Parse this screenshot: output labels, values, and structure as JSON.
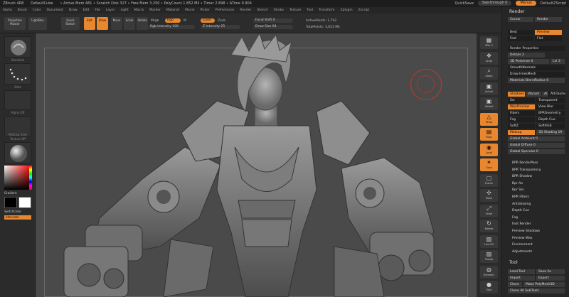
{
  "titlebar": {
    "app": "ZBrush 4R8",
    "document": "DefaultCube",
    "stats": "• Active Mem 481 • Scratch Disk 327 • Free Mem 3.250 • PolyCount 1.852 Mil • Timer 2.898 • ATime 9.904",
    "quicksave": "QuickSave",
    "see_through": "See-through 0",
    "menus": "Menus",
    "script": "DefaultZScript"
  },
  "menubar": [
    "Alpha",
    "Brush",
    "Color",
    "Document",
    "Draw",
    "Edit",
    "File",
    "Layer",
    "Light",
    "Macro",
    "Marker",
    "Material",
    "Movie",
    "Picker",
    "Preferences",
    "Render",
    "Stencil",
    "Stroke",
    "Texture",
    "Tool",
    "Transform",
    "Zplugin",
    "Zscript"
  ],
  "toolbar": {
    "projection_master": "Projection Master",
    "lightbox": "LightBox",
    "quick_sketch": "Quick Sketch",
    "edit": "Edit",
    "draw": "Draw",
    "move": "Move",
    "scale": "Scale",
    "rotate": "Rotate",
    "mrgb": "Mrgb",
    "rgb": "Rgb",
    "m": "M",
    "rgb_intensity": "Rgb Intensity",
    "zadd": "Zadd",
    "zsub": "Zsub",
    "z_intensity": "Z Intensity 25",
    "focal_shift": "Focal Shift 0",
    "draw_size": "Draw Size 64",
    "active_points": "ActivePoints: 1,792",
    "total_points": "TotalPoints: 3,653 Mil"
  },
  "leftshelf": {
    "labels": [
      "Standard",
      "Dots",
      "Alpha Off",
      "Texture Off",
      "MatCap Gray"
    ],
    "gradient": "Gradient",
    "switch_color": "SwitchColor",
    "alternate": "Alternate"
  },
  "rightshelf": [
    {
      "label": "SPix 3",
      "glyph": "▦",
      "orange": false
    },
    {
      "label": "Scroll",
      "glyph": "✥",
      "orange": false
    },
    {
      "label": "Zoom",
      "glyph": "⌕",
      "orange": false
    },
    {
      "label": "Actual",
      "glyph": "▣",
      "orange": false
    },
    {
      "label": "AAHalf",
      "glyph": "▣",
      "orange": false
    },
    {
      "label": "Persp",
      "glyph": "△",
      "orange": true
    },
    {
      "label": "Floor",
      "glyph": "▤",
      "orange": true
    },
    {
      "label": "Local",
      "glyph": "◉",
      "orange": true
    },
    {
      "label": "Gxyz",
      "glyph": "✶",
      "orange": true
    },
    {
      "label": "Frame",
      "glyph": "▢",
      "orange": false
    },
    {
      "label": "Move",
      "glyph": "✣",
      "orange": false
    },
    {
      "label": "Scale",
      "glyph": "⤢",
      "orange": false
    },
    {
      "label": "Rotate",
      "glyph": "↻",
      "orange": false
    },
    {
      "label": "Line Fill",
      "glyph": "▧",
      "orange": false
    },
    {
      "label": "Transp",
      "glyph": "▨",
      "orange": false
    },
    {
      "label": "Dynamic",
      "glyph": "◍",
      "orange": false
    },
    {
      "label": "Solo",
      "glyph": "●",
      "orange": false
    }
  ],
  "render_tray": {
    "title": "Render",
    "cursor": "Cursor",
    "render": "Render",
    "best": "Best",
    "preview": "Preview",
    "fast": "Fast",
    "flat": "Flat",
    "render_properties": "Render Properties",
    "details": "Details 2",
    "3d_posterize": "3D Posterize 0",
    "lvl": "Lvl 3",
    "smooth_normals": "SmoothNormals",
    "draw_hires": "Draw HiresMesh",
    "materials_blend": "Materials BlendRadius 0",
    "shadows": "Shadows",
    "vibrant": "Vibrant",
    "ao": "AO",
    "attributes": "Attributes",
    "ssr": "Ssr",
    "transparent": "Transparent",
    "wax_preview": "WaxPreview",
    "view_blur": "View Blur",
    "fibers": "Fibers",
    "bpr_geometry": "BPRGeometry",
    "fog": "Fog",
    "depth_cue": "Depth Cue",
    "soft_z": "SoftZ",
    "soft_rgb": "SoftRGB",
    "matcap": "Matcap",
    "3d_shading": "3D Shading 19",
    "global_ambient": "Global Ambient 0",
    "global_diffuse": "Global Diffuse 0",
    "global_specular": "Global Specular 0",
    "sub_items": [
      "BPR RenderPass",
      "BPR Transparency",
      "BPR Shadow",
      "Bpr Ao",
      "Bpr Sss",
      "BPR Filters",
      "Antialiasing",
      "Depth Cue",
      "Fog",
      "Fast Render",
      "Preview Shadows",
      "Preview Wax",
      "Environment",
      "Adjustments"
    ]
  },
  "tool_tray": {
    "title": "Tool",
    "load_tool": "Load Tool",
    "save_as": "Save As",
    "import": "Import",
    "export": "Export",
    "clone": "Clone",
    "make_polymesh": "Make PolyMesh3D",
    "clone_all": "Clone All SubTools"
  }
}
